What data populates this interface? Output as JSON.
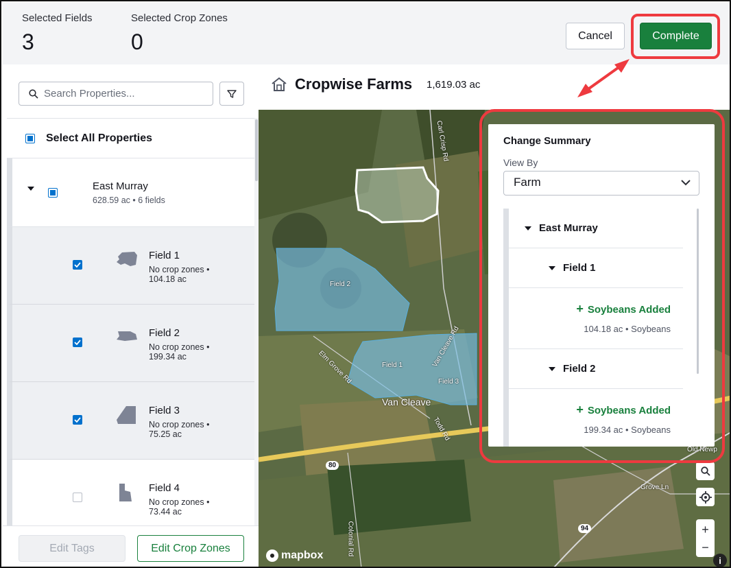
{
  "header": {
    "selected_fields_label": "Selected Fields",
    "selected_fields_value": "3",
    "selected_crop_zones_label": "Selected Crop Zones",
    "selected_crop_zones_value": "0",
    "cancel_label": "Cancel",
    "complete_label": "Complete"
  },
  "left": {
    "search_placeholder": "Search Properties...",
    "select_all_label": "Select All Properties",
    "farm": {
      "name": "East Murray",
      "meta": "628.59 ac • 6 fields"
    },
    "fields": [
      {
        "name": "Field 1",
        "sub1": "No crop zones •",
        "sub2": "104.18 ac",
        "checked": true
      },
      {
        "name": "Field 2",
        "sub1": "No crop zones •",
        "sub2": "199.34 ac",
        "checked": true
      },
      {
        "name": "Field 3",
        "sub1": "No crop zones •",
        "sub2": "75.25 ac",
        "checked": true
      },
      {
        "name": "Field 4",
        "sub1": "No crop zones •",
        "sub2": "73.44 ac",
        "checked": false
      }
    ],
    "edit_tags_label": "Edit Tags",
    "edit_crop_zones_label": "Edit Crop Zones"
  },
  "map_header": {
    "title": "Cropwise Farms",
    "acres": "1,619.03 ac"
  },
  "map": {
    "labels": [
      "Field 2",
      "Field 1",
      "Field 3",
      "Van Cleave",
      "Carl Crisp Rd",
      "Elm Grove Rd",
      "Van Cleave Rd",
      "Todd Rd",
      "Grove Ln",
      "Old Newp",
      "Colonial Rd",
      "80",
      "94"
    ],
    "attribution": "mapbox"
  },
  "summary": {
    "title": "Change Summary",
    "view_by_label": "View By",
    "view_by_value": "Farm",
    "farm_name": "East Murray",
    "items": [
      {
        "field": "Field 1",
        "change": "Soybeans Added",
        "detail": "104.18 ac • Soybeans"
      },
      {
        "field": "Field 2",
        "change": "Soybeans Added",
        "detail": "199.34 ac • Soybeans"
      }
    ]
  },
  "colors": {
    "accent_green": "#19803d",
    "highlight_red": "#ee3a3f",
    "checkbox_blue": "#0071cd"
  }
}
